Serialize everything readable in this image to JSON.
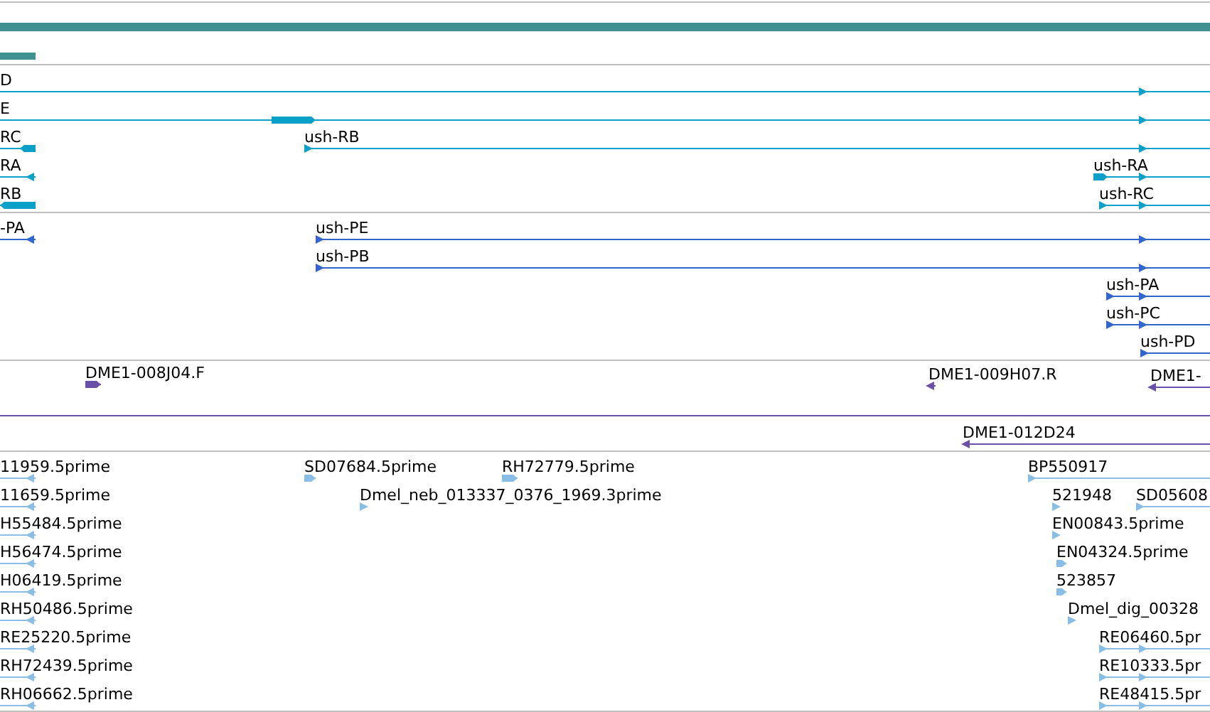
{
  "tracks": [
    {
      "kind": "coverage"
    },
    {
      "kind": "transcript",
      "features": [
        {
          "label": "D",
          "reverse": false
        },
        {
          "label": "E",
          "reverse": false
        },
        {
          "label": "RC",
          "reverse": true
        },
        {
          "label": "ush-RB",
          "reverse": false
        },
        {
          "label": "RA",
          "reverse": true
        },
        {
          "label": "ush-RA",
          "reverse": false
        },
        {
          "label": "RB",
          "reverse": true
        },
        {
          "label": "ush-RC",
          "reverse": false
        }
      ]
    },
    {
      "kind": "protein",
      "features": [
        {
          "label": "-PA",
          "reverse": true
        },
        {
          "label": "ush-PE",
          "reverse": false
        },
        {
          "label": "ush-PB",
          "reverse": false
        },
        {
          "label": "ush-PA",
          "reverse": false
        },
        {
          "label": "ush-PC",
          "reverse": false
        },
        {
          "label": "ush-PD",
          "reverse": false
        }
      ]
    },
    {
      "kind": "clone",
      "features": [
        {
          "label": "DME1-008J04.F",
          "reverse": false
        },
        {
          "label": "DME1-009H07.R",
          "reverse": true
        },
        {
          "label": "DME1-",
          "reverse": true
        },
        {
          "label": "DME1-012D24",
          "reverse": true
        }
      ]
    },
    {
      "kind": "est",
      "features": [
        {
          "label": "11959.5prime",
          "reverse": true
        },
        {
          "label": "11659.5prime",
          "reverse": true
        },
        {
          "label": "H55484.5prime",
          "reverse": true
        },
        {
          "label": "H56474.5prime",
          "reverse": true
        },
        {
          "label": "H06419.5prime",
          "reverse": true
        },
        {
          "label": "RH50486.5prime",
          "reverse": true
        },
        {
          "label": "RE25220.5prime",
          "reverse": true
        },
        {
          "label": "RH72439.5prime",
          "reverse": true
        },
        {
          "label": "RH06662.5prime",
          "reverse": true
        },
        {
          "label": "SD07684.5prime",
          "reverse": false
        },
        {
          "label": "RH72779.5prime",
          "reverse": false
        },
        {
          "label": "Dmel_neb_013337_0376_1969.3prime",
          "reverse": false
        },
        {
          "label": "BP550917",
          "reverse": false
        },
        {
          "label": "521948",
          "reverse": false
        },
        {
          "label": "SD05608",
          "reverse": false
        },
        {
          "label": "EN00843.5prime",
          "reverse": false
        },
        {
          "label": "EN04324.5prime",
          "reverse": false
        },
        {
          "label": "523857",
          "reverse": false
        },
        {
          "label": "Dmel_dig_00328",
          "reverse": false
        },
        {
          "label": "RE06460.5pr",
          "reverse": false
        },
        {
          "label": "RE10333.5pr",
          "reverse": false
        },
        {
          "label": "RE48415.5pr",
          "reverse": false
        }
      ]
    }
  ]
}
